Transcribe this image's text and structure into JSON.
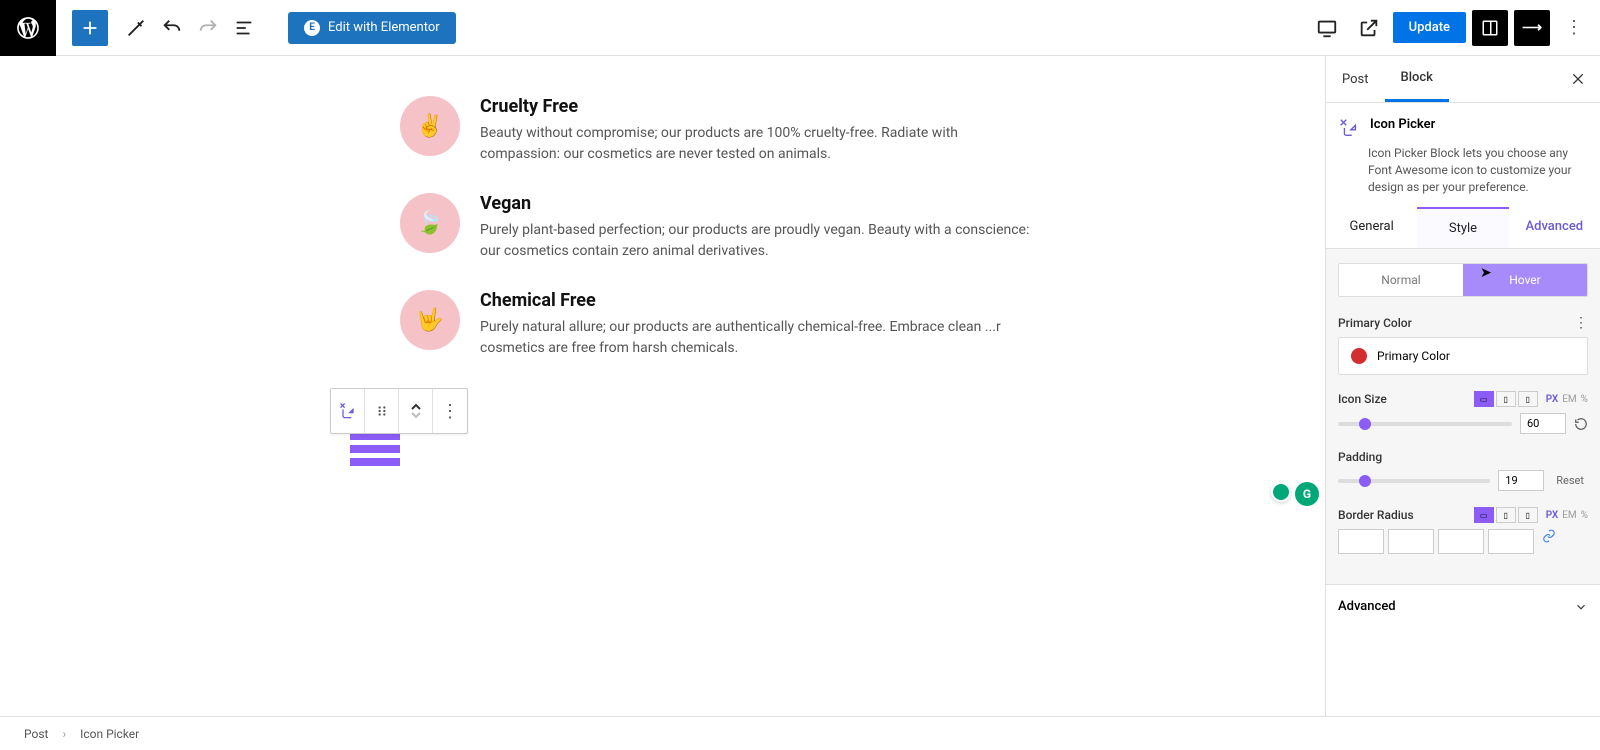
{
  "toolbar": {
    "elementor_label": "Edit with Elementor",
    "update_label": "Update"
  },
  "canvas": {
    "features": [
      {
        "title": "Cruelty Free",
        "desc": "Beauty without compromise; our products are 100% cruelty-free. Radiate with compassion: our cosmetics are never tested on animals.",
        "icon": "✌"
      },
      {
        "title": "Vegan",
        "desc": "Purely plant-based perfection; our products are proudly vegan. Beauty with a conscience: our cosmetics contain zero animal derivatives.",
        "icon": "🍃"
      },
      {
        "title": "Chemical Free",
        "desc": "Purely natural allure; our products are authentically chemical-free. Embrace clean ...r cosmetics are free from harsh chemicals.",
        "icon": "🤟"
      }
    ]
  },
  "sidebar": {
    "tabs": {
      "post": "Post",
      "block": "Block"
    },
    "block_name": "Icon Picker",
    "block_desc": "Icon Picker Block lets you choose any Font Awesome icon to customize your design as per your preference.",
    "panel_tabs": {
      "general": "General",
      "style": "Style",
      "advanced": "Advanced"
    },
    "state": {
      "normal": "Normal",
      "hover": "Hover"
    },
    "primary_color_label": "Primary Color",
    "primary_color_field": "Primary Color",
    "primary_color_value": "#d32f2f",
    "icon_size_label": "Icon Size",
    "icon_size_value": "60",
    "padding_label": "Padding",
    "padding_value": "19",
    "padding_reset": "Reset",
    "border_radius_label": "Border Radius",
    "units": {
      "px": "PX",
      "em": "EM",
      "pct": "%"
    },
    "advanced_section": "Advanced"
  },
  "breadcrumb": {
    "root": "Post",
    "current": "Icon Picker"
  }
}
